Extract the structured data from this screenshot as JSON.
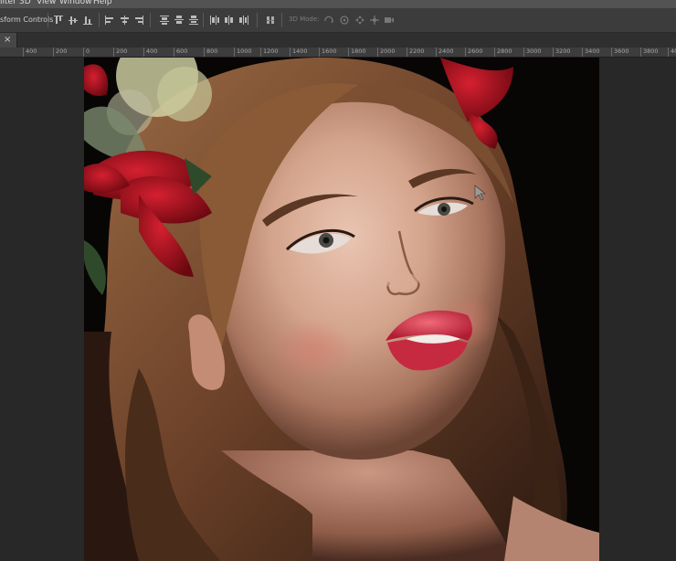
{
  "menubar": {
    "items": [
      "ilter",
      "3D",
      "View",
      "Window",
      "Help"
    ]
  },
  "options_bar": {
    "transform_label": "sform Controls",
    "mode_3d_label": "3D Mode:",
    "icons": [
      "align-top-icon",
      "align-vcenter-icon",
      "align-bottom-icon",
      "align-left-icon",
      "align-hcenter-icon",
      "align-right-icon",
      "distribute-top-icon",
      "distribute-vcenter-icon",
      "distribute-bottom-icon",
      "distribute-left-icon",
      "distribute-hcenter-icon",
      "distribute-right-icon",
      "auto-align-icon",
      "rotate-3d-icon",
      "roll-3d-icon",
      "drag-3d-icon",
      "slide-3d-icon",
      "scale-3d-icon"
    ]
  },
  "tab": {
    "close_glyph": "×"
  },
  "ruler": {
    "labels": [
      "400",
      "200",
      "0",
      "200",
      "400",
      "600",
      "800",
      "1000",
      "1200",
      "1400",
      "1600",
      "1800",
      "2000",
      "2200",
      "2400",
      "2600",
      "2800",
      "3000",
      "3200",
      "3400",
      "3600",
      "3800",
      "40"
    ]
  },
  "colors": {
    "menubar": "#535353",
    "options_bar": "#3c3c3c",
    "workspace": "#282828",
    "canvas_background": "#060404"
  }
}
